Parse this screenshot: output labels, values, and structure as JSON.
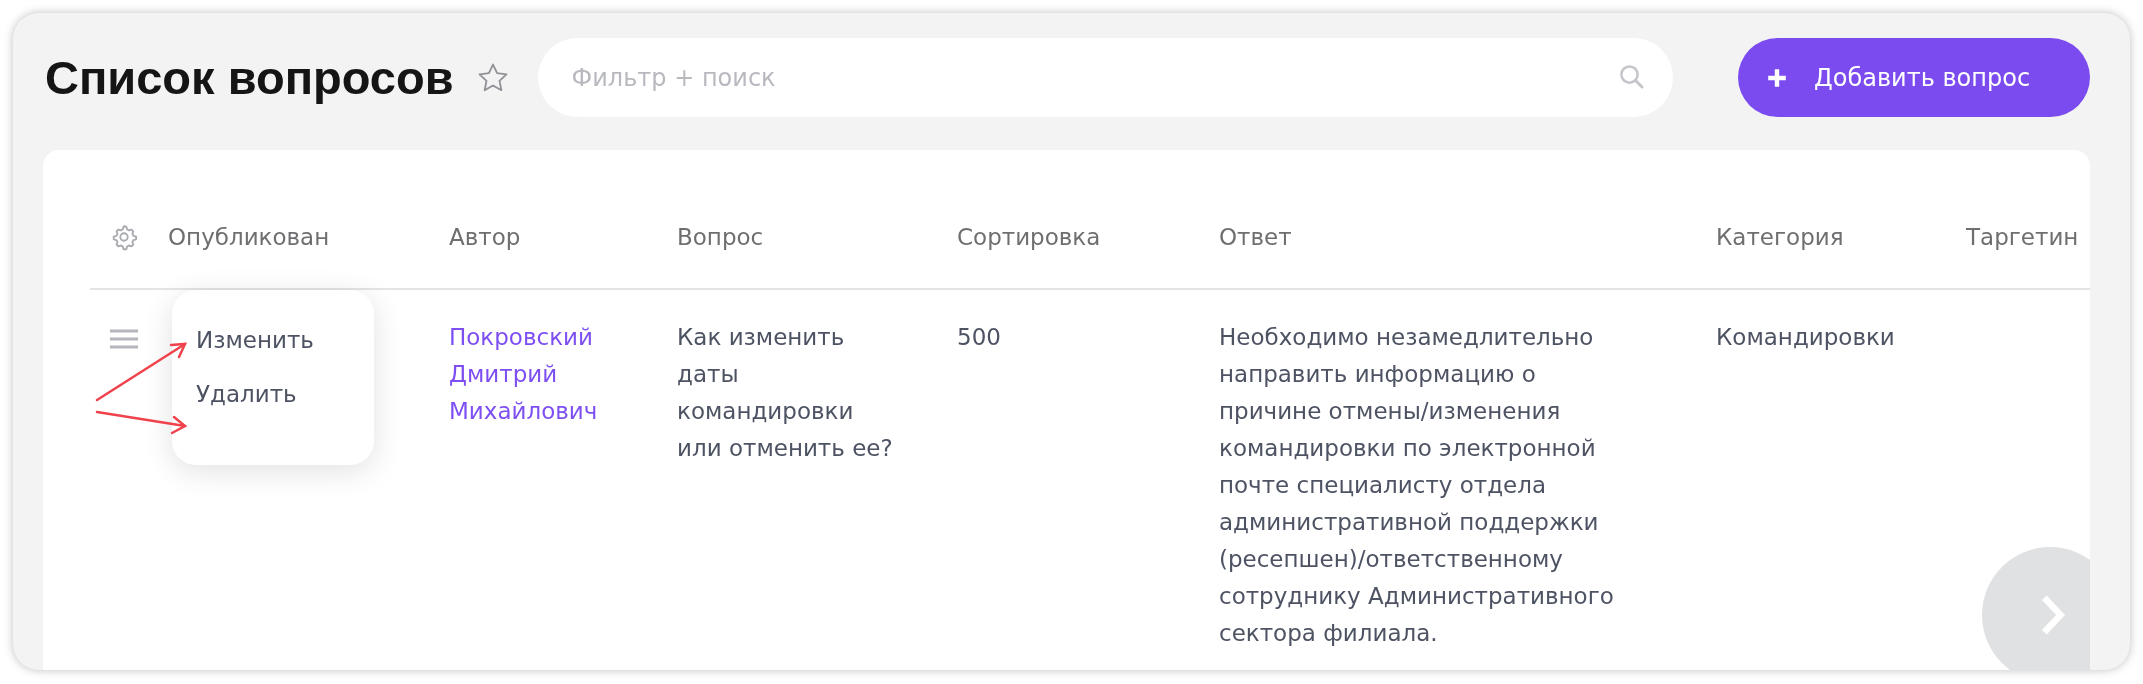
{
  "page": {
    "title": "Список вопросов",
    "favorite": false
  },
  "search": {
    "placeholder": "Фильтр + поиск"
  },
  "add_button": {
    "label": "Добавить вопрос"
  },
  "table": {
    "columns": [
      "Опубликован",
      "Автор",
      "Вопрос",
      "Сортировка",
      "Ответ",
      "Категория",
      "Таргетин"
    ],
    "rows": [
      {
        "author": "Покровский Дмитрий Михайлович",
        "question": "Как изменить даты командировки или отменить ее?",
        "sort": "500",
        "answer": "Необходимо незамедлительно направить информацию о причине отмены/изменения командировки по электронной почте специалисту отдела административной поддержки (ресепшен)/ответственному сотруднику Административного сектора филиала.",
        "category": "Командировки"
      }
    ]
  },
  "row_menu": {
    "items": [
      "Изменить",
      "Удалить"
    ]
  }
}
